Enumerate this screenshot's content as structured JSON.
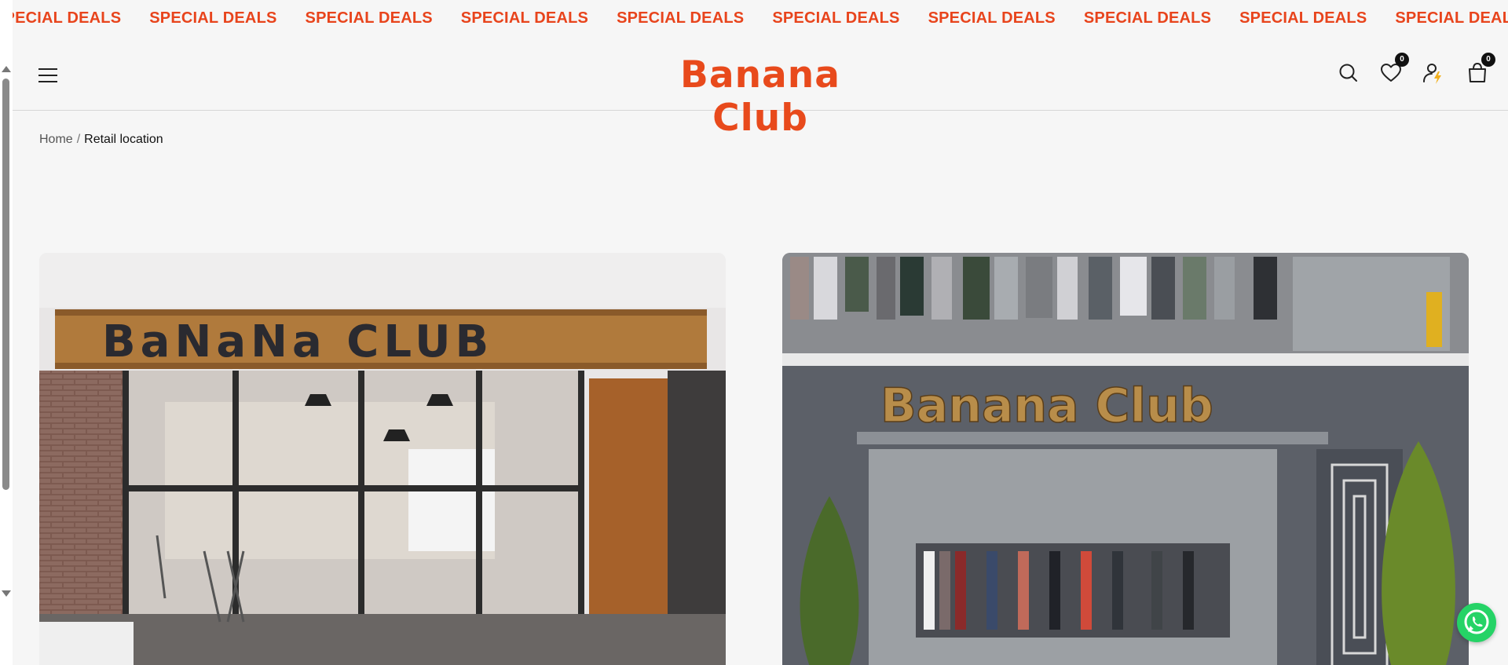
{
  "marquee": {
    "items": [
      "SPECIAL DEALS",
      "SPECIAL DEALS",
      "SPECIAL DEALS",
      "SPECIAL DEALS",
      "SPECIAL DEALS",
      "SPECIAL DEALS",
      "SPECIAL DEALS",
      "SPECIAL DEALS",
      "SPECIAL DEALS",
      "SPECIAL DEALS",
      "SPECIAL DEALS"
    ],
    "color": "#e8441c"
  },
  "header": {
    "logo": "Banana Club",
    "logo_color": "#e84a1c",
    "wishlist_count": "0",
    "cart_count": "0",
    "icons": [
      "menu-icon",
      "search-icon",
      "heart-icon",
      "user-icon",
      "cart-icon"
    ]
  },
  "breadcrumb": {
    "home": "Home",
    "separator": "/",
    "current": "Retail location"
  },
  "stores": {
    "left": {
      "sign": "BaNaNa CLUB"
    },
    "right": {
      "sign": "Banana Club"
    }
  },
  "whatsapp": {
    "icon": "whatsapp-icon",
    "color": "#25d366"
  }
}
